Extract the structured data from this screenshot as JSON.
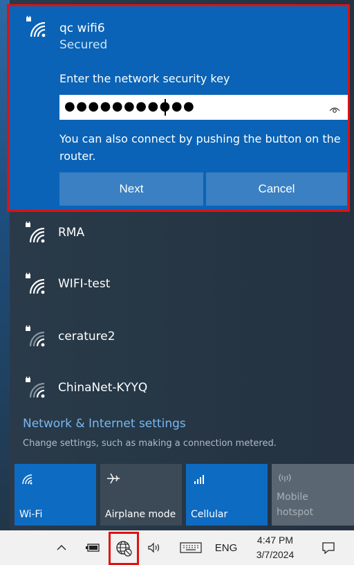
{
  "active_network": {
    "ssid": "qc wifi6",
    "status": "Secured",
    "prompt": "Enter the network security key",
    "key_value": "●●●●●●●●●●●",
    "help": "You can also connect by pushing the button on the router.",
    "next_label": "Next",
    "cancel_label": "Cancel"
  },
  "networks": [
    {
      "name": "RMA",
      "icon": "wifi-secured-icon"
    },
    {
      "name": "WIFI-test",
      "icon": "wifi-secured-icon"
    },
    {
      "name": "cerature2",
      "icon": "wifi-secured-icon"
    },
    {
      "name": "ChinaNet-KYYQ",
      "icon": "wifi-secured-icon"
    }
  ],
  "settings": {
    "link": "Network & Internet settings",
    "description": "Change settings, such as making a connection metered."
  },
  "quick_actions": [
    {
      "label": "Wi-Fi",
      "icon": "wifi-icon",
      "active": true
    },
    {
      "label": "Airplane mode",
      "icon": "airplane-icon",
      "active": false
    },
    {
      "label": "Cellular",
      "icon": "cellular-icon",
      "active": true
    },
    {
      "label": "Mobile\nhotspot",
      "icon": "hotspot-icon",
      "active": false
    }
  ],
  "taskbar": {
    "language": "ENG",
    "time": "4:47 PM",
    "date": "3/7/2024"
  },
  "colors": {
    "accent": "#0a63b6",
    "flyout_bg": "#2a3a4a",
    "link": "#79b8f3",
    "highlight_border": "#e01010"
  }
}
